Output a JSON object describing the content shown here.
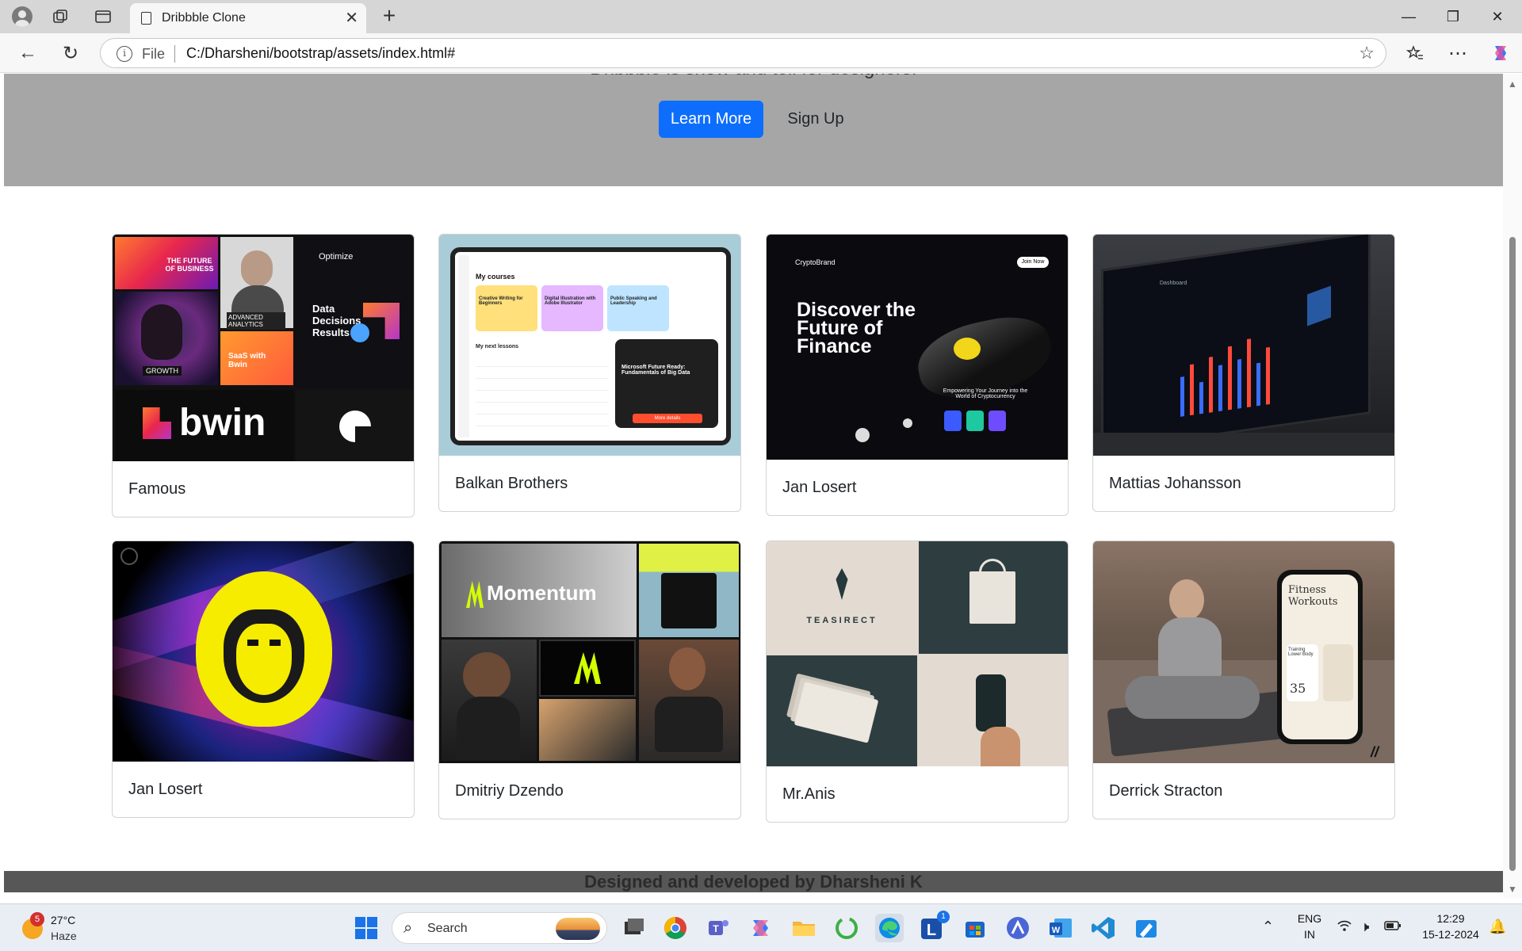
{
  "browser": {
    "tab_title": "Dribbble Clone",
    "url_scheme": "File",
    "url": "C:/Dharsheni/bootstrap/assets/index.html#"
  },
  "hero": {
    "tagline": "Dribbble is show and tell for designers.",
    "primary_button": "Learn More",
    "secondary_button": "Sign Up"
  },
  "cards": [
    {
      "title": "Famous"
    },
    {
      "title": "Balkan Brothers"
    },
    {
      "title": "Jan Losert"
    },
    {
      "title": "Mattias Johansson"
    },
    {
      "title": "Jan Losert"
    },
    {
      "title": "Dmitriy Dzendo"
    },
    {
      "title": "Mr.Anis"
    },
    {
      "title": "Derrick Stracton"
    }
  ],
  "card_art": {
    "bwin": {
      "tile_future": "THE FUTURE OF BUSINESS",
      "tile_optimize": "Optimize",
      "tile_analytics": "ADVANCED ANALYTICS",
      "tile_data": "Data Decisions Results",
      "tile_growth": "GROWTH",
      "tile_saas": "SaaS with Bwin",
      "logo": "bwin"
    },
    "courses": {
      "heading": "My courses",
      "lessons": "My next lessons",
      "course_1": "Creative Writing for Beginners",
      "course_2": "Digital Illustration with Adobe Illustrator",
      "course_3": "Public Speaking and Leadership",
      "promo": "Microsoft Future Ready: Fundamentals of Big Data",
      "promo_btn": "More details"
    },
    "finance": {
      "brand": "CryptoBrand",
      "headline": "Discover the Future of Finance",
      "sub": "Empowering Your Journey into the World of Cryptocurrency",
      "cta": "Join Now"
    },
    "dashboard": {
      "label": "Dashboard"
    },
    "momentum": {
      "brand": "Momentum"
    },
    "teasirect": {
      "brand": "TEASIRECT"
    },
    "fitness": {
      "title": "Fitness Workouts",
      "stat": "35",
      "card": "Training Lower Body"
    }
  },
  "footer": {
    "text": "Designed and developed by Dharsheni K"
  },
  "taskbar": {
    "weather_temp": "27°C",
    "weather_cond": "Haze",
    "weather_badge": "5",
    "search_placeholder": "Search",
    "lang_top": "ENG",
    "lang_bottom": "IN",
    "time": "12:29",
    "date": "15-12-2024",
    "app_badge": "1"
  },
  "colors": {
    "primary": "#0d6efd",
    "hero_bg": "#a6a6a6",
    "footer_bg": "#575757"
  }
}
